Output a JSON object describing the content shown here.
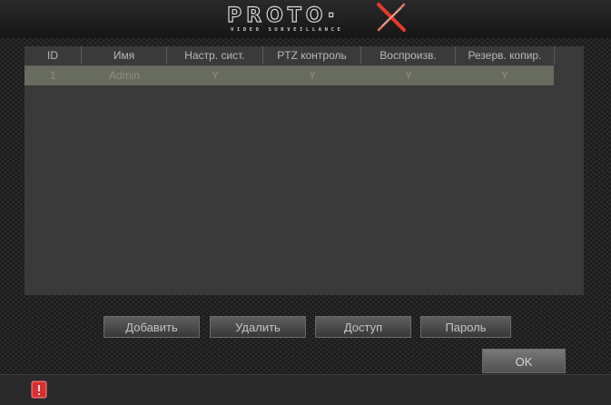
{
  "logo": {
    "main": "PROTO·",
    "subtitle": "VIDEO SURVEILLANCE"
  },
  "table": {
    "columns": [
      "ID",
      "Имя",
      "Настр. сист.",
      "PTZ контроль",
      "Воспроизв.",
      "Резерв. копир."
    ],
    "rows": [
      {
        "id": "1",
        "name": "Admin",
        "settings": "Y",
        "ptz": "Y",
        "playback": "Y",
        "backup": "Y"
      }
    ]
  },
  "buttons": {
    "add": "Добавить",
    "delete": "Удалить",
    "access": "Доступ",
    "password": "Пароль",
    "ok": "OK"
  },
  "icons": {
    "logo_x": "logo-x-icon",
    "alarm": "alarm-indicator-icon"
  },
  "colors": {
    "background": "#1a1a1a",
    "table_bg": "#3a3a3a",
    "row_selected": "#686b60",
    "alarm": "#d83030",
    "logo_x": "#e63a2a"
  }
}
